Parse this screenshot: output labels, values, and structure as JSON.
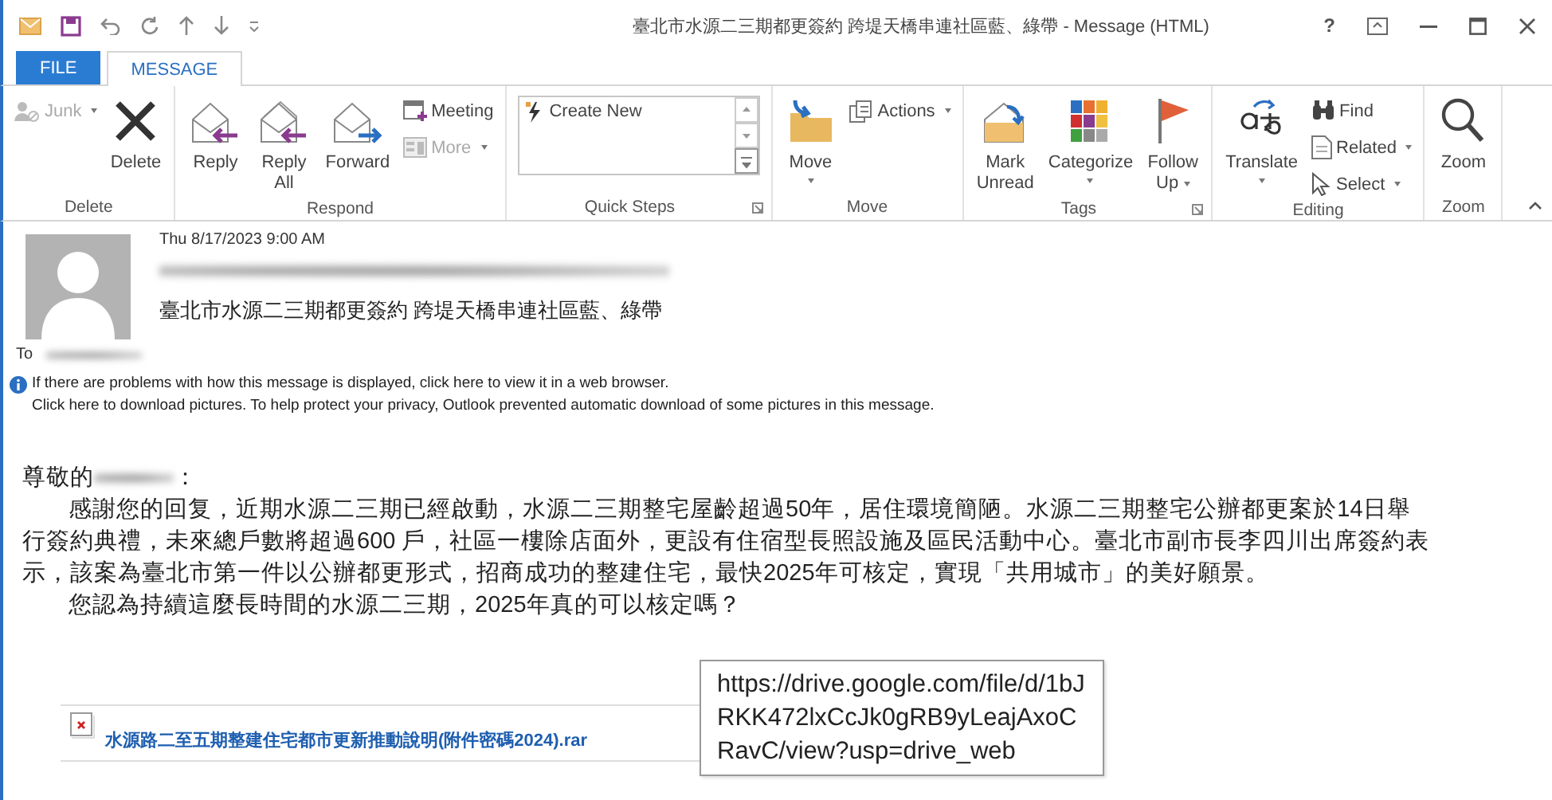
{
  "window": {
    "title": "臺北市水源二三期都更簽約 跨堤天橋串連社區藍、綠帶 - Message (HTML)",
    "help": "?"
  },
  "tabs": [
    {
      "label": "FILE",
      "selected": false,
      "kind": "file"
    },
    {
      "label": "MESSAGE",
      "selected": true,
      "kind": "tab"
    }
  ],
  "ribbon": {
    "groups": [
      {
        "name": "Delete",
        "launcher": false,
        "buttons": [
          {
            "label": "Junk",
            "kind": "small",
            "dropdown": true,
            "disabled": true
          },
          {
            "label": "Delete",
            "kind": "large",
            "dropdown": false,
            "disabled": false
          }
        ]
      },
      {
        "name": "Respond",
        "launcher": false,
        "buttons": [
          {
            "label": "Reply",
            "kind": "large",
            "dropdown": false,
            "disabled": false
          },
          {
            "label": "Reply All",
            "kind": "large",
            "dropdown": false,
            "disabled": false
          },
          {
            "label": "Forward",
            "kind": "large",
            "dropdown": false,
            "disabled": false
          },
          {
            "label": "Meeting",
            "kind": "small",
            "dropdown": false,
            "disabled": false
          },
          {
            "label": "More",
            "kind": "small",
            "dropdown": true,
            "disabled": true
          }
        ]
      },
      {
        "name": "Quick Steps",
        "launcher": true,
        "buttons": [
          {
            "label": "Create New",
            "kind": "gallery",
            "disabled": false
          }
        ]
      },
      {
        "name": "Move",
        "launcher": false,
        "buttons": [
          {
            "label": "Move",
            "kind": "large-menu",
            "dropdown": true,
            "disabled": false
          },
          {
            "label": "Actions",
            "kind": "small",
            "dropdown": true,
            "disabled": false
          }
        ]
      },
      {
        "name": "Tags",
        "launcher": true,
        "buttons": [
          {
            "label": "Mark Unread",
            "kind": "large",
            "dropdown": false,
            "disabled": false
          },
          {
            "label": "Categorize",
            "kind": "large-menu",
            "dropdown": true,
            "disabled": false
          },
          {
            "label": "Follow Up",
            "kind": "large",
            "dropdown": true,
            "disabled": false
          }
        ]
      },
      {
        "name": "Editing",
        "launcher": false,
        "buttons": [
          {
            "label": "Translate",
            "kind": "large-menu",
            "dropdown": true,
            "disabled": false
          },
          {
            "label": "Find",
            "kind": "small",
            "dropdown": false,
            "disabled": false
          },
          {
            "label": "Related",
            "kind": "small",
            "dropdown": true,
            "disabled": false
          },
          {
            "label": "Select",
            "kind": "small",
            "dropdown": true,
            "disabled": false
          }
        ]
      },
      {
        "name": "Zoom",
        "launcher": false,
        "buttons": [
          {
            "label": "Zoom",
            "kind": "large",
            "dropdown": false,
            "disabled": false
          }
        ]
      }
    ]
  },
  "message": {
    "date": "Thu 8/17/2023 9:00 AM",
    "subject": "臺北市水源二三期都更簽約 跨堤天橋串連社區藍、綠帶",
    "to_label": "To",
    "info": [
      "If there are problems with how this message is displayed, click here to view it in a web browser.",
      "Click here to download pictures. To help protect your privacy, Outlook prevented automatic download of some pictures in this message."
    ]
  },
  "body": {
    "greeting": "尊敬的",
    "greeting_end": "：",
    "paragraphs": [
      "感謝您的回复，近期水源二三期已經啟動，水源二三期整宅屋齡超過50年，居住環境簡陋。水源二三期整宅公辦都更案於14日舉行簽約典禮，未來總戶數將超過600 戶，社區一樓除店面外，更設有住宿型長照設施及區民活動中心。臺北市副市長李四川出席簽約表示，該案為臺北市第一件以公辦都更形式，招商成功的整建住宅，最快2025年可核定，實現「共用城市」的美好願景。",
      "您認為持續這麼長時間的水源二三期，2025年真的可以核定嗎？"
    ],
    "attachment": "水源路二至五期整建住宅都市更新推動說明(附件密碼2024).rar",
    "tooltip": "https://drive.google.com/file/d/1bJRKK472lxCcJk0gRB9yLeajAxoCRavC/view?usp=drive_web"
  }
}
